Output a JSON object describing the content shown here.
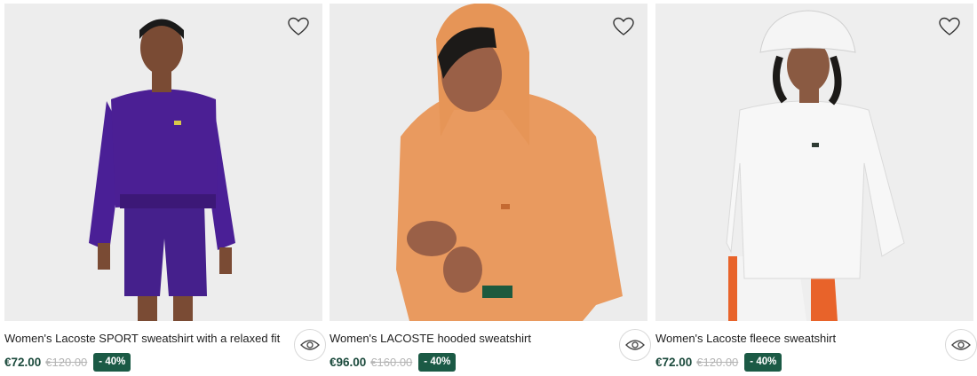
{
  "products": [
    {
      "name": "Women's Lacoste SPORT sweatshirt with a relaxed fit",
      "price": "€72.00",
      "old_price": "€120.00",
      "discount": "- 40%",
      "garment_color": "#4b1f94"
    },
    {
      "name": "Women's LACOSTE hooded sweatshirt",
      "price": "€96.00",
      "old_price": "€160.00",
      "discount": "- 40%",
      "garment_color": "#e99a5f"
    },
    {
      "name": "Women's Lacoste fleece sweatshirt",
      "price": "€72.00",
      "old_price": "€120.00",
      "discount": "- 40%",
      "garment_color": "#f6f6f6"
    }
  ],
  "icons": {
    "wishlist": "heart-icon",
    "quickview": "eye-icon"
  },
  "colors": {
    "price": "#1b4a3c",
    "discount_badge": "#1b5a45",
    "old_price": "#b4b4b4"
  }
}
